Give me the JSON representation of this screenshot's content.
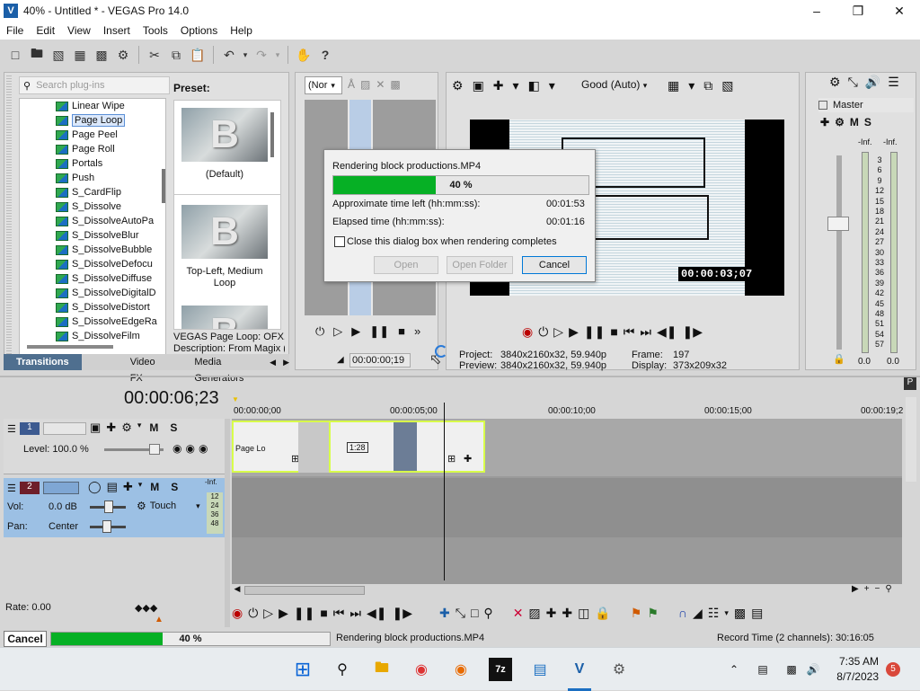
{
  "window": {
    "title": "40% - Untitled * - VEGAS Pro 14.0",
    "app_icon": "vegas-app-icon",
    "minimize": "–",
    "restore": "❐",
    "close": "✕"
  },
  "menu": [
    "File",
    "Edit",
    "View",
    "Insert",
    "Tools",
    "Options",
    "Help"
  ],
  "plugins": {
    "search_placeholder": "Search plug-ins",
    "items": [
      "Linear Wipe",
      "Page Loop",
      "Page Peel",
      "Page Roll",
      "Portals",
      "Push",
      "S_CardFlip",
      "S_Dissolve",
      "S_DissolveAutoPa",
      "S_DissolveBlur",
      "S_DissolveBubble",
      "S_DissolveDefocu",
      "S_DissolveDiffuse",
      "S_DissolveDigitalD",
      "S_DissolveDistort",
      "S_DissolveEdgeRa",
      "S_DissolveFilm"
    ],
    "selected": "Page Loop",
    "preset_label": "Preset:",
    "presets": [
      {
        "letter": "B",
        "caption": "(Default)"
      },
      {
        "letter": "B",
        "caption": "Top-Left, Medium Loop"
      },
      {
        "letter": "B",
        "caption": ""
      }
    ],
    "desc_line1": "VEGAS Page Loop: OFX,",
    "desc_line2": "Description: From Magix (",
    "tabs": [
      "Transitions",
      "Video FX",
      "Media Generators"
    ]
  },
  "trimmer": {
    "select_value": "(Nor",
    "time": "00:00:00;19"
  },
  "preview": {
    "quality": "Good (Auto)",
    "frame_time": "00:00:03;07",
    "project_label": "Project:",
    "project_value": "3840x2160x32, 59.940p",
    "preview_label": "Preview:",
    "preview_value": "3840x2160x32, 59.940p",
    "frame_label": "Frame:",
    "frame_value": "197",
    "display_label": "Display:",
    "display_value": "373x209x32"
  },
  "mixer": {
    "title": "Master",
    "left_db": "-Inf.",
    "right_db": "-Inf.",
    "scale": [
      "3",
      "6",
      "9",
      "12",
      "15",
      "18",
      "21",
      "24",
      "27",
      "30",
      "33",
      "36",
      "39",
      "42",
      "45",
      "48",
      "51",
      "54",
      "57"
    ],
    "out_left": "0.0",
    "out_right": "0.0"
  },
  "dialog": {
    "title": "Rendering block productions.MP4",
    "percent": "40 %",
    "progress": 0.4,
    "time_left_label": "Approximate time left (hh:mm:ss):",
    "time_left": "00:01:53",
    "elapsed_label": "Elapsed time (hh:mm:ss):",
    "elapsed": "00:01:16",
    "close_when_done": "Close this dialog box when rendering completes",
    "open": "Open",
    "open_folder": "Open Folder",
    "cancel": "Cancel"
  },
  "timeline": {
    "cursor_time": "00:00:06;23",
    "ruler": [
      "00:00:00;00",
      "00:00:05;00",
      "00:00:10;00",
      "00:00:15;00",
      "00:00:19;2"
    ],
    "track1": {
      "number": "1",
      "level": "Level: 100.0 %"
    },
    "track2": {
      "number": "2",
      "vol_label": "Vol:",
      "vol": "0.0 dB",
      "pan_label": "Pan:",
      "pan": "Center",
      "touch": "Touch",
      "inf": "-Inf.",
      "meter": [
        "12",
        "24",
        "36",
        "48"
      ]
    },
    "clip1_label": "Page Lo",
    "clip2_label": "1:28",
    "rate": "Rate: 0.00"
  },
  "status": {
    "cancel": "Cancel",
    "percent": "40 %",
    "progress": 0.4,
    "message": "Rendering block productions.MP4",
    "record_time": "Record Time (2 channels): 30:16:05"
  },
  "taskbar": {
    "time": "7:35 AM",
    "date": "8/7/2023",
    "badge": "5"
  },
  "colors": {
    "progress": "#06b025",
    "accent": "#0078d7",
    "track2": "#9cc0e4",
    "clip_border": "#d8ff4a"
  }
}
